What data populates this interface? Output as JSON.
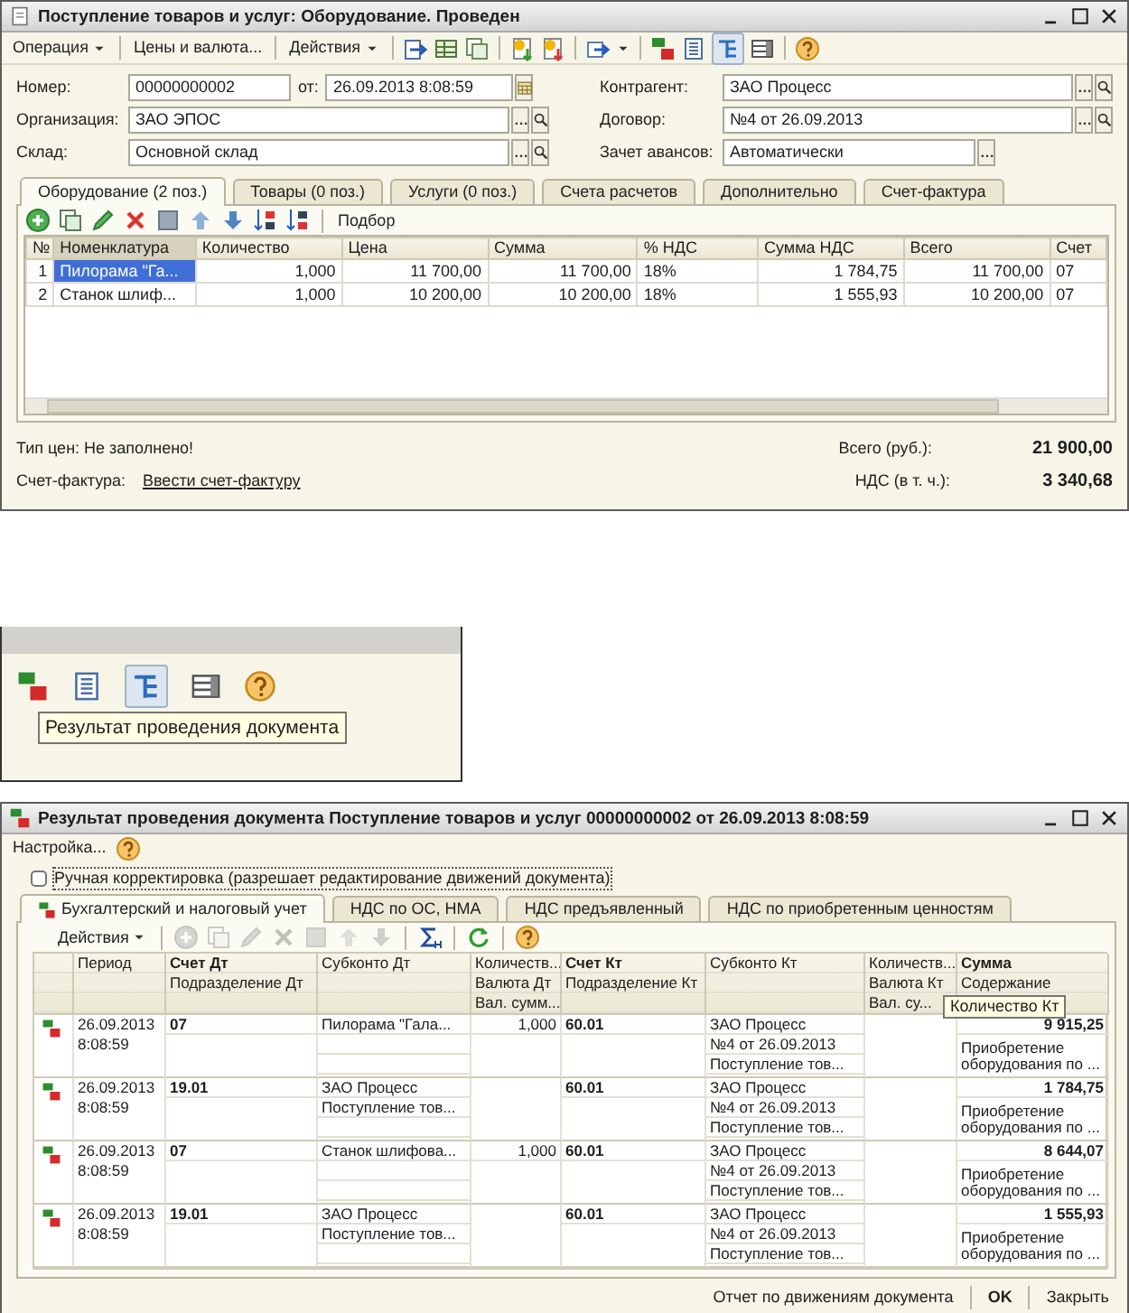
{
  "document_window": {
    "title": "Поступление товаров и услуг: Оборудование. Проведен",
    "toolbar": [
      {
        "kind": "menu",
        "label": "Операция"
      },
      {
        "kind": "separator"
      },
      {
        "kind": "button",
        "label": "Цены и валюта..."
      },
      {
        "kind": "separator"
      },
      {
        "kind": "menu",
        "label": "Действия"
      },
      {
        "kind": "separator"
      },
      {
        "kind": "post"
      },
      {
        "kind": "movements"
      },
      {
        "kind": "copy-doc"
      },
      {
        "kind": "separator"
      },
      {
        "kind": "doc-up"
      },
      {
        "kind": "doc-down"
      },
      {
        "kind": "separator"
      },
      {
        "kind": "go-to",
        "dropdown": true
      },
      {
        "kind": "separator"
      },
      {
        "kind": "dt-kt"
      },
      {
        "kind": "report"
      },
      {
        "kind": "structure",
        "pressed": true
      },
      {
        "kind": "list"
      },
      {
        "kind": "separator"
      },
      {
        "kind": "help"
      }
    ],
    "left_fields": [
      {
        "label": "Номер:",
        "value": "00000000002",
        "date_label": "от:",
        "date_value": "26.09.2013  8:08:59",
        "calendar_button": true
      },
      {
        "label": "Организация:",
        "value": "ЗАО ЭПОС",
        "choice_button": true,
        "search_button": true
      },
      {
        "label": "Склад:",
        "value": "Основной склад",
        "choice_button": true,
        "search_button": true
      }
    ],
    "right_fields": [
      {
        "label": "Контрагент:",
        "value": "ЗАО Процесс",
        "choice_button": true,
        "search_button": true
      },
      {
        "label": "Договор:",
        "value": "№4 от 26.09.2013",
        "choice_button": true,
        "search_button": true
      },
      {
        "label": "Зачет авансов:",
        "value": "Автоматически",
        "choice_button": true,
        "search_button": false
      }
    ],
    "tabs": [
      {
        "label": "Оборудование (2 поз.)",
        "selected": true
      },
      {
        "label": "Товары (0 поз.)",
        "selected": false
      },
      {
        "label": "Услуги (0 поз.)",
        "selected": false
      },
      {
        "label": "Счета расчетов",
        "selected": false
      },
      {
        "label": "Дополнительно",
        "selected": false
      },
      {
        "label": "Счет-фактура",
        "selected": false
      }
    ],
    "table_toolbar": [
      {
        "kind": "add"
      },
      {
        "kind": "copy"
      },
      {
        "kind": "edit"
      },
      {
        "kind": "delete"
      },
      {
        "kind": "save"
      },
      {
        "kind": "up"
      },
      {
        "kind": "down"
      },
      {
        "kind": "sort-asc"
      },
      {
        "kind": "sort-desc"
      },
      {
        "kind": "separator"
      },
      {
        "kind": "button",
        "label": "Подбор"
      }
    ],
    "table": {
      "columns": [
        {
          "label": "№",
          "kind": "number",
          "selected": false
        },
        {
          "label": "Номенклатура",
          "kind": "text",
          "selected": true
        },
        {
          "label": "Количество",
          "kind": "number",
          "selected": false
        },
        {
          "label": "Цена",
          "kind": "number",
          "selected": false
        },
        {
          "label": "Сумма",
          "kind": "number",
          "selected": false
        },
        {
          "label": "% НДС",
          "kind": "text",
          "selected": false
        },
        {
          "label": "Сумма НДС",
          "kind": "number",
          "selected": false
        },
        {
          "label": "Всего",
          "kind": "number",
          "selected": false
        },
        {
          "label": "Счет",
          "kind": "text",
          "selected": false
        }
      ],
      "rows": [
        {
          "selected": true,
          "cells": [
            "1",
            "Пилорама \"Га...",
            "1,000",
            "11 700,00",
            "11 700,00",
            "18%",
            "1 784,75",
            "11 700,00",
            "07"
          ]
        },
        {
          "selected": false,
          "cells": [
            "2",
            "Станок шлиф...",
            "1,000",
            "10 200,00",
            "10 200,00",
            "18%",
            "1 555,93",
            "10 200,00",
            "07"
          ]
        }
      ]
    },
    "footer": {
      "price_type": "Тип цен: Не заполнено!",
      "total_label": "Всего (руб.):",
      "total": "21 900,00",
      "invoice_label": "Счет-фактура:",
      "invoice_link": "Ввести счет-фактуру",
      "vat_label": "НДС (в т. ч.):",
      "vat": "3 340,68"
    }
  },
  "toolbar_closeup": {
    "toolbar": [
      {
        "kind": "dt-kt",
        "pressed": false
      },
      {
        "kind": "report",
        "pressed": false
      },
      {
        "kind": "structure",
        "pressed": true
      },
      {
        "kind": "list",
        "pressed": false
      },
      {
        "kind": "help",
        "pressed": false
      }
    ],
    "tooltip": "Результат проведения документа"
  },
  "result_window": {
    "title": "Результат проведения документа Поступление товаров и услуг 00000000002 от 26.09.2013 8:08:59",
    "menu": [
      {
        "kind": "button",
        "label": "Настройка..."
      },
      {
        "kind": "help"
      }
    ],
    "manual_edit": {
      "label": "Ручная корректировка (разрешает редактирование движений документа)",
      "checked": false
    },
    "tabs": [
      {
        "label": "Бухгалтерский и налоговый учет",
        "selected": true
      },
      {
        "label": "НДС по ОС, НМА",
        "selected": false
      },
      {
        "label": "НДС предъявленный",
        "selected": false
      },
      {
        "label": "НДС по приобретенным ценностям",
        "selected": false
      }
    ],
    "toolbar": [
      {
        "kind": "menu",
        "label": "Действия"
      },
      {
        "kind": "separator"
      },
      {
        "kind": "add",
        "disabled": true
      },
      {
        "kind": "copy",
        "disabled": true
      },
      {
        "kind": "edit",
        "disabled": true
      },
      {
        "kind": "delete",
        "disabled": true
      },
      {
        "kind": "save",
        "disabled": true
      },
      {
        "kind": "up",
        "disabled": true
      },
      {
        "kind": "down",
        "disabled": true
      },
      {
        "kind": "separator"
      },
      {
        "kind": "sum",
        "disabled": false
      },
      {
        "kind": "separator"
      },
      {
        "kind": "refresh",
        "disabled": false
      },
      {
        "kind": "separator"
      },
      {
        "kind": "help",
        "disabled": false
      }
    ],
    "columns": [
      {
        "kind": "icon"
      },
      {
        "kind": "period",
        "lines": [
          "Период"
        ]
      },
      {
        "kind": "account",
        "lines": [
          "Счет Дт",
          "Подразделение Дт"
        ]
      },
      {
        "kind": "subconto",
        "lines": [
          "Субконто Дт"
        ]
      },
      {
        "kind": "quantity",
        "lines": [
          "Количеств...",
          "Валюта Дт",
          "Вал. сумм..."
        ]
      },
      {
        "kind": "account",
        "lines": [
          "Счет Кт",
          "Подразделение Кт"
        ]
      },
      {
        "kind": "subconto",
        "lines": [
          "Субконто Кт"
        ]
      },
      {
        "kind": "quantity",
        "lines": [
          "Количеств...",
          "Валюта Кт",
          "Вал. су..."
        ]
      },
      {
        "kind": "amount",
        "lines": [
          "Сумма",
          "Содержание"
        ]
      }
    ],
    "header_tooltip": "Количество Кт",
    "rows": [
      {
        "period": "26.09.2013 8:08:59",
        "account_dt": "07",
        "subconto_dt": [
          "Пилорама \"Гала..."
        ],
        "quantity_dt": "1,000",
        "account_kt": "60.01",
        "subconto_kt": [
          "ЗАО Процесс",
          "№4 от 26.09.2013",
          "Поступление тов..."
        ],
        "amount": "9 915,25",
        "content": "Приобретение оборудования по ..."
      },
      {
        "period": "26.09.2013 8:08:59",
        "account_dt": "19.01",
        "subconto_dt": [
          "ЗАО Процесс",
          "Поступление тов..."
        ],
        "account_kt": "60.01",
        "subconto_kt": [
          "ЗАО Процесс",
          "№4 от 26.09.2013",
          "Поступление тов..."
        ],
        "amount": "1 784,75",
        "content": "Приобретение оборудования по ..."
      },
      {
        "period": "26.09.2013 8:08:59",
        "account_dt": "07",
        "subconto_dt": [
          "Станок шлифова..."
        ],
        "quantity_dt": "1,000",
        "account_kt": "60.01",
        "subconto_kt": [
          "ЗАО Процесс",
          "№4 от 26.09.2013",
          "Поступление тов..."
        ],
        "amount": "8 644,07",
        "content": "Приобретение оборудования по ..."
      },
      {
        "period": "26.09.2013 8:08:59",
        "account_dt": "19.01",
        "subconto_dt": [
          "ЗАО Процесс",
          "Поступление тов..."
        ],
        "account_kt": "60.01",
        "subconto_kt": [
          "ЗАО Процесс",
          "№4 от 26.09.2013",
          "Поступление тов..."
        ],
        "amount": "1 555,93",
        "content": "Приобретение оборудования по ..."
      }
    ],
    "footer": [
      {
        "label": "Отчет по движениям документа",
        "primary": false
      },
      {
        "label": "OK",
        "primary": true
      },
      {
        "label": "Закрыть",
        "primary": false
      }
    ]
  }
}
